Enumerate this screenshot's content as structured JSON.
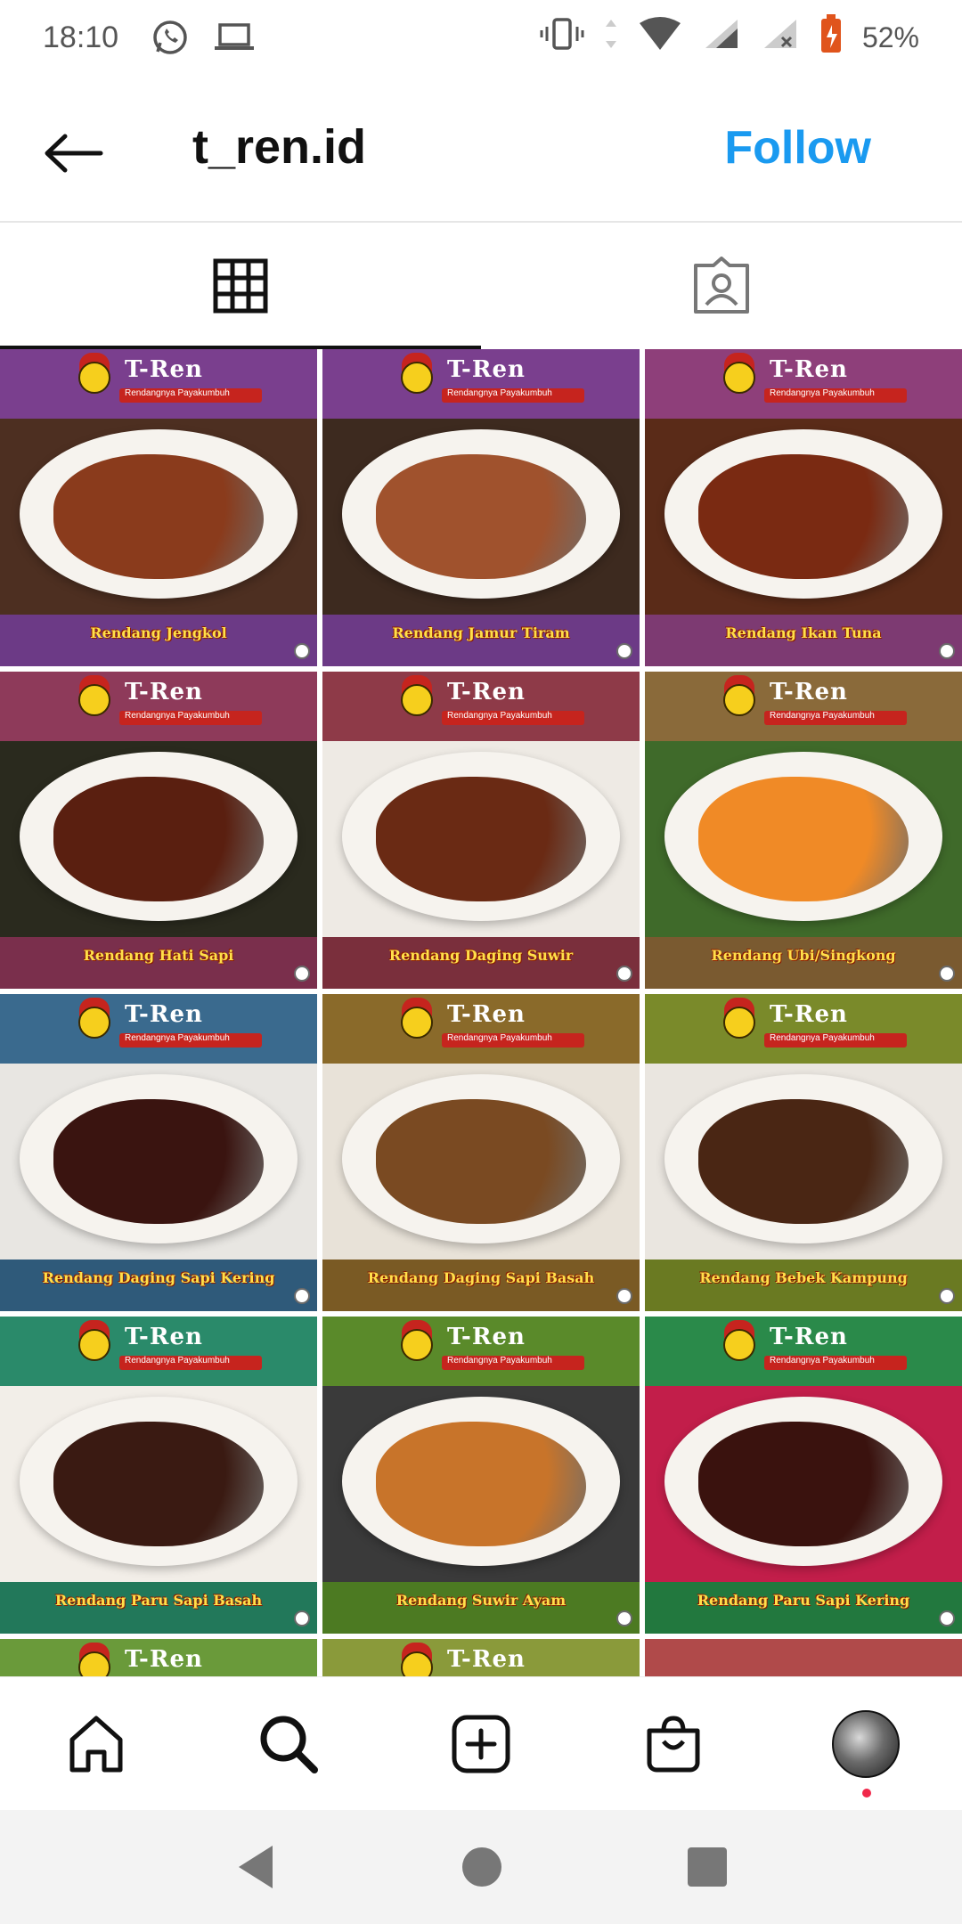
{
  "status_bar": {
    "time": "18:10",
    "battery_percent": "52%"
  },
  "header": {
    "title": "t_ren.id",
    "follow_label": "Follow"
  },
  "tabs": [
    {
      "name": "grid",
      "icon": "grid-icon",
      "active": true
    },
    {
      "name": "tagged",
      "icon": "tagged-user-icon",
      "active": false
    }
  ],
  "posts": [
    {
      "caption": "Rendang Jengkol",
      "brand": "T-Ren",
      "tagline": "Rendangnya Payakumbuh",
      "banner_color": "#7a3f8e",
      "bottom_color": "#6c3a86",
      "bg_color": "#4d2f21",
      "food_color": "#8a3b1c"
    },
    {
      "caption": "Rendang Jamur Tiram",
      "brand": "T-Ren",
      "tagline": "Rendangnya Payakumbuh",
      "banner_color": "#7a3f8e",
      "bottom_color": "#6c3a86",
      "bg_color": "#3d2a1f",
      "food_color": "#a0522d"
    },
    {
      "caption": "Rendang Ikan Tuna",
      "brand": "T-Ren",
      "tagline": "Rendangnya Payakumbuh",
      "banner_color": "#8e3f7a",
      "bottom_color": "#7d3a72",
      "bg_color": "#5a2b18",
      "food_color": "#7a2a12"
    },
    {
      "caption": "Rendang Hati Sapi",
      "brand": "T-Ren",
      "tagline": "Rendangnya Payakumbuh",
      "banner_color": "#8e3a5a",
      "bottom_color": "#7a2f4c",
      "bg_color": "#2a2a1e",
      "food_color": "#5a1f10"
    },
    {
      "caption": "Rendang Daging Suwir",
      "brand": "T-Ren",
      "tagline": "Rendangnya Payakumbuh",
      "banner_color": "#8e3a48",
      "bottom_color": "#7a2f3c",
      "bg_color": "#eeeae4",
      "food_color": "#6a2a14"
    },
    {
      "caption": "Rendang Ubi/Singkong",
      "brand": "T-Ren",
      "tagline": "Rendangnya Payakumbuh",
      "banner_color": "#8a6a3a",
      "bottom_color": "#7a5a30",
      "bg_color": "#3f6a2a",
      "food_color": "#f08a26"
    },
    {
      "caption": "Rendang Daging Sapi Kering",
      "brand": "T-Ren",
      "tagline": "Rendangnya Payakumbuh",
      "banner_color": "#3a6a8e",
      "bottom_color": "#2f5a7a",
      "bg_color": "#e8e6e2",
      "food_color": "#3a1410"
    },
    {
      "caption": "Rendang Daging Sapi Basah",
      "brand": "T-Ren",
      "tagline": "Rendangnya Payakumbuh",
      "banner_color": "#8a6a2a",
      "bottom_color": "#7a5a24",
      "bg_color": "#e8e2d8",
      "food_color": "#7a4a22"
    },
    {
      "caption": "Rendang Bebek Kampung",
      "brand": "T-Ren",
      "tagline": "Rendangnya Payakumbuh",
      "banner_color": "#7a8a2a",
      "bottom_color": "#6a7a22",
      "bg_color": "#eae6e0",
      "food_color": "#4a2614"
    },
    {
      "caption": "Rendang Paru Sapi Basah",
      "brand": "T-Ren",
      "tagline": "Rendangnya Payakumbuh",
      "banner_color": "#2a8a6a",
      "bottom_color": "#22785a",
      "bg_color": "#f2eee8",
      "food_color": "#3a1a12"
    },
    {
      "caption": "Rendang Suwir Ayam",
      "brand": "T-Ren",
      "tagline": "Rendangnya Payakumbuh",
      "banner_color": "#5a8a2a",
      "bottom_color": "#4c7a22",
      "bg_color": "#3a3a3a",
      "food_color": "#c8742a"
    },
    {
      "caption": "Rendang Paru Sapi Kering",
      "brand": "T-Ren",
      "tagline": "Rendangnya Payakumbuh",
      "banner_color": "#2a8a4a",
      "bottom_color": "#22783e",
      "bg_color": "#c21e4a",
      "food_color": "#3a120e"
    },
    {
      "caption": "",
      "brand": "T-Ren",
      "tagline": "",
      "banner_color": "#6a9a3a",
      "bottom_color": "#6a9a3a",
      "bg_color": "#6a9a3a",
      "food_color": "#6a9a3a"
    },
    {
      "caption": "",
      "brand": "T-Ren",
      "tagline": "",
      "banner_color": "#8a9a3a",
      "bottom_color": "#8a9a3a",
      "bg_color": "#8a9a3a",
      "food_color": "#8a9a3a"
    },
    {
      "caption": "",
      "brand": "",
      "tagline": "",
      "banner_color": "#b04a4a",
      "bottom_color": "#b04a4a",
      "bg_color": "#b04a4a",
      "food_color": "#b04a4a"
    }
  ],
  "bottom_nav": [
    {
      "name": "home",
      "icon": "home-icon"
    },
    {
      "name": "search",
      "icon": "search-icon"
    },
    {
      "name": "create",
      "icon": "add-post-icon"
    },
    {
      "name": "shop",
      "icon": "shopping-bag-icon"
    },
    {
      "name": "profile",
      "icon": "avatar"
    }
  ],
  "colors": {
    "follow_blue": "#1a9af0",
    "notification_dot": "#f0284a"
  }
}
